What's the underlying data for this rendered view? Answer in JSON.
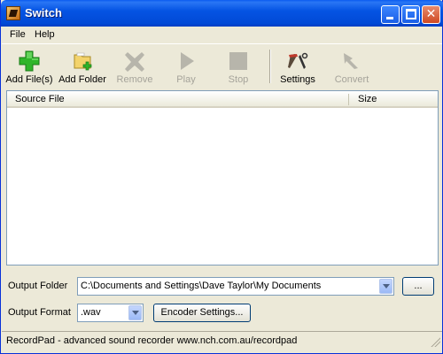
{
  "window": {
    "title": "Switch"
  },
  "titlebar": {
    "minimize_glyph": "",
    "maximize_glyph": "",
    "close_glyph": "✕"
  },
  "menu": {
    "items": [
      "File",
      "Help"
    ]
  },
  "toolbar": {
    "buttons": [
      {
        "label": "Add File(s)",
        "icon": "add-files-icon",
        "enabled": true
      },
      {
        "label": "Add Folder",
        "icon": "add-folder-icon",
        "enabled": true
      },
      {
        "label": "Remove",
        "icon": "remove-icon",
        "enabled": false
      },
      {
        "label": "Play",
        "icon": "play-icon",
        "enabled": false
      },
      {
        "label": "Stop",
        "icon": "stop-icon",
        "enabled": false
      },
      {
        "label": "Settings",
        "icon": "settings-icon",
        "enabled": true
      },
      {
        "label": "Convert",
        "icon": "convert-icon",
        "enabled": false
      }
    ]
  },
  "filelist": {
    "columns": [
      "Source File",
      "Size"
    ],
    "rows": []
  },
  "output": {
    "folder_label": "Output Folder",
    "folder_value": "C:\\Documents and Settings\\Dave Taylor\\My Documents",
    "browse_label": "...",
    "format_label": "Output Format",
    "format_value": ".wav",
    "encoder_label": "Encoder Settings..."
  },
  "status": {
    "text": "RecordPad - advanced sound recorder www.nch.com.au/recordpad"
  },
  "colors": {
    "titlebar": "#0554e3",
    "face": "#ece9d8",
    "add_green": "#2fb52a",
    "disabled_gray": "#a5a39a"
  }
}
